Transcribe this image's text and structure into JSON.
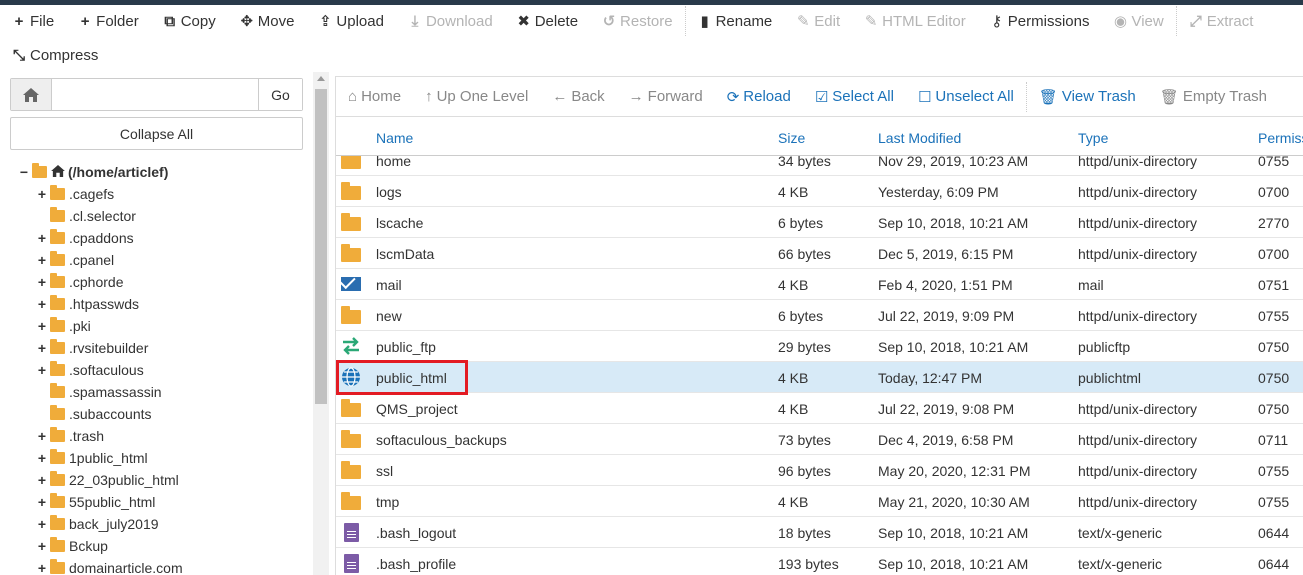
{
  "toolbar": {
    "row1": [
      {
        "name": "file-button",
        "icon": "plus-icon",
        "glyph": "+",
        "label": "File",
        "disabled": false
      },
      {
        "name": "folder-button",
        "icon": "plus-icon",
        "glyph": "+",
        "label": "Folder",
        "disabled": false
      },
      {
        "name": "copy-button",
        "icon": "copy-icon",
        "glyph": "⧉",
        "label": "Copy",
        "disabled": false
      },
      {
        "name": "move-button",
        "icon": "move-icon",
        "glyph": "✥",
        "label": "Move",
        "disabled": false
      },
      {
        "name": "upload-button",
        "icon": "upload-icon",
        "glyph": "⇪",
        "label": "Upload",
        "disabled": false
      },
      {
        "name": "download-button",
        "icon": "download-icon",
        "glyph": "⤓",
        "label": "Download",
        "disabled": true
      },
      {
        "name": "delete-button",
        "icon": "close-icon",
        "glyph": "✖",
        "label": "Delete",
        "disabled": false
      },
      {
        "name": "restore-button",
        "icon": "undo-icon",
        "glyph": "↺",
        "label": "Restore",
        "disabled": true
      },
      {
        "name": "rename-button",
        "icon": "file-icon",
        "glyph": "▮",
        "label": "Rename",
        "disabled": false
      },
      {
        "name": "edit-button",
        "icon": "pencil-icon",
        "glyph": "✎",
        "label": "Edit",
        "disabled": true
      },
      {
        "name": "html-editor-button",
        "icon": "edit-box-icon",
        "glyph": "✎",
        "label": "HTML Editor",
        "disabled": true
      },
      {
        "name": "permissions-button",
        "icon": "key-icon",
        "glyph": "⚷",
        "label": "Permissions",
        "disabled": false
      },
      {
        "name": "view-button",
        "icon": "eye-icon",
        "glyph": "◉",
        "label": "View",
        "disabled": true
      },
      {
        "name": "extract-button",
        "icon": "expand-icon",
        "glyph": "⤢",
        "label": "Extract",
        "disabled": true
      }
    ],
    "row2": [
      {
        "name": "compress-button",
        "icon": "compress-icon",
        "glyph": "⤡",
        "label": "Compress",
        "disabled": false
      }
    ]
  },
  "left": {
    "path_value": "",
    "go_label": "Go",
    "collapse_label": "Collapse All",
    "tree": [
      {
        "label": "(/home/articlef)",
        "toggle": "−",
        "root": true,
        "home": true
      },
      {
        "label": ".cagefs",
        "toggle": "+"
      },
      {
        "label": ".cl.selector",
        "toggle": ""
      },
      {
        "label": ".cpaddons",
        "toggle": "+"
      },
      {
        "label": ".cpanel",
        "toggle": "+"
      },
      {
        "label": ".cphorde",
        "toggle": "+"
      },
      {
        "label": ".htpasswds",
        "toggle": "+"
      },
      {
        "label": ".pki",
        "toggle": "+"
      },
      {
        "label": ".rvsitebuilder",
        "toggle": "+"
      },
      {
        "label": ".softaculous",
        "toggle": "+"
      },
      {
        "label": ".spamassassin",
        "toggle": ""
      },
      {
        "label": ".subaccounts",
        "toggle": ""
      },
      {
        "label": ".trash",
        "toggle": "+"
      },
      {
        "label": "1public_html",
        "toggle": "+"
      },
      {
        "label": "22_03public_html",
        "toggle": "+"
      },
      {
        "label": "55public_html",
        "toggle": "+"
      },
      {
        "label": "back_july2019",
        "toggle": "+"
      },
      {
        "label": "Bckup",
        "toggle": "+"
      },
      {
        "label": "domainarticle.com",
        "toggle": "+"
      }
    ]
  },
  "nav": [
    {
      "name": "home-nav-button",
      "icon": "home-icon",
      "glyph": "⌂",
      "label": "Home",
      "blue": false
    },
    {
      "name": "up-one-level-button",
      "icon": "level-up-icon",
      "glyph": "↑",
      "label": "Up One Level",
      "blue": false
    },
    {
      "name": "back-button",
      "icon": "arrow-left-icon",
      "glyph": "←",
      "label": "Back",
      "blue": false
    },
    {
      "name": "forward-button",
      "icon": "arrow-right-icon",
      "glyph": "→",
      "label": "Forward",
      "blue": false
    },
    {
      "name": "reload-button",
      "icon": "refresh-icon",
      "glyph": "⟳",
      "label": "Reload",
      "blue": true
    },
    {
      "name": "select-all-button",
      "icon": "checkbox-checked-icon",
      "glyph": "☑",
      "label": "Select All",
      "blue": true
    },
    {
      "name": "unselect-all-button",
      "icon": "checkbox-empty-icon",
      "glyph": "☐",
      "label": "Unselect All",
      "blue": true
    },
    {
      "name": "view-trash-button",
      "icon": "trash-icon",
      "glyph": "🗑",
      "label": "View Trash",
      "blue": true
    },
    {
      "name": "empty-trash-button",
      "icon": "trash-icon",
      "glyph": "🗑",
      "label": "Empty Trash",
      "blue": false
    }
  ],
  "table": {
    "headers": {
      "name": "Name",
      "size": "Size",
      "modified": "Last Modified",
      "type": "Type",
      "perms": "Permiss"
    },
    "rows": [
      {
        "icon": "folder",
        "name": "home",
        "size": "34 bytes",
        "modified": "Nov 29, 2019, 10:23 AM",
        "type": "httpd/unix-directory",
        "perms": "0755"
      },
      {
        "icon": "folder",
        "name": "logs",
        "size": "4 KB",
        "modified": "Yesterday, 6:09 PM",
        "type": "httpd/unix-directory",
        "perms": "0700"
      },
      {
        "icon": "folder",
        "name": "lscache",
        "size": "6 bytes",
        "modified": "Sep 10, 2018, 10:21 AM",
        "type": "httpd/unix-directory",
        "perms": "2770"
      },
      {
        "icon": "folder",
        "name": "lscmData",
        "size": "66 bytes",
        "modified": "Dec 5, 2019, 6:15 PM",
        "type": "httpd/unix-directory",
        "perms": "0700"
      },
      {
        "icon": "mail",
        "name": "mail",
        "size": "4 KB",
        "modified": "Feb 4, 2020, 1:51 PM",
        "type": "mail",
        "perms": "0751"
      },
      {
        "icon": "folder",
        "name": "new",
        "size": "6 bytes",
        "modified": "Jul 22, 2019, 9:09 PM",
        "type": "httpd/unix-directory",
        "perms": "0755"
      },
      {
        "icon": "ftp",
        "name": "public_ftp",
        "size": "29 bytes",
        "modified": "Sep 10, 2018, 10:21 AM",
        "type": "publicftp",
        "perms": "0750"
      },
      {
        "icon": "globe",
        "name": "public_html",
        "size": "4 KB",
        "modified": "Today, 12:47 PM",
        "type": "publichtml",
        "perms": "0750",
        "selected": true
      },
      {
        "icon": "folder",
        "name": "QMS_project",
        "size": "4 KB",
        "modified": "Jul 22, 2019, 9:08 PM",
        "type": "httpd/unix-directory",
        "perms": "0750"
      },
      {
        "icon": "folder",
        "name": "softaculous_backups",
        "size": "73 bytes",
        "modified": "Dec 4, 2019, 6:58 PM",
        "type": "httpd/unix-directory",
        "perms": "0711"
      },
      {
        "icon": "folder",
        "name": "ssl",
        "size": "96 bytes",
        "modified": "May 20, 2020, 12:31 PM",
        "type": "httpd/unix-directory",
        "perms": "0755"
      },
      {
        "icon": "folder",
        "name": "tmp",
        "size": "4 KB",
        "modified": "May 21, 2020, 10:30 AM",
        "type": "httpd/unix-directory",
        "perms": "0755"
      },
      {
        "icon": "doc",
        "name": ".bash_logout",
        "size": "18 bytes",
        "modified": "Sep 10, 2018, 10:21 AM",
        "type": "text/x-generic",
        "perms": "0644"
      },
      {
        "icon": "doc",
        "name": ".bash_profile",
        "size": "193 bytes",
        "modified": "Sep 10, 2018, 10:21 AM",
        "type": "text/x-generic",
        "perms": "0644"
      }
    ]
  },
  "colors": {
    "accent": "#1b72b9",
    "folder": "#f0ac3a",
    "selected_row": "#d7eaf7",
    "highlight": "#e31b23",
    "topbar": "#293a4a"
  }
}
